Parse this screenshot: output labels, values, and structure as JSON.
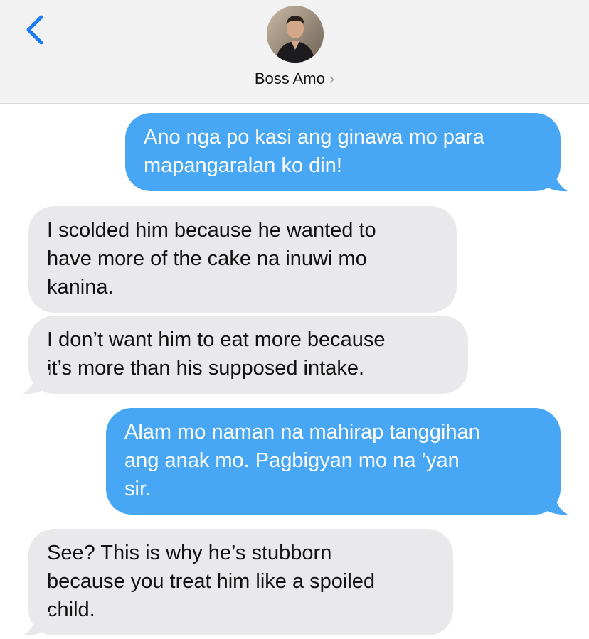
{
  "header": {
    "contact_name": "Boss Amo",
    "chevron": "›",
    "back_icon": "chevron-left-icon",
    "accent": "#1a7cf5"
  },
  "colors": {
    "outgoing_bubble": "#47a7f5",
    "incoming_bubble": "#e9e9eb"
  },
  "messages": [
    {
      "direction": "outgoing",
      "lines": [
        "Ano nga po kasi ang ginawa mo para",
        "mapangaralan ko din!"
      ]
    },
    {
      "direction": "incoming",
      "lines": [
        "I scolded him because he wanted to",
        "have more of the cake na inuwi mo",
        "kanina."
      ]
    },
    {
      "direction": "incoming",
      "lines": [
        "I don’t want him to eat more because",
        "it’s more than his supposed intake."
      ]
    },
    {
      "direction": "outgoing",
      "lines": [
        "Alam mo naman na mahirap tanggihan",
        "ang anak mo. Pagbigyan mo na ’yan",
        "sir."
      ]
    },
    {
      "direction": "incoming",
      "lines": [
        "See? This is why he’s stubborn",
        "because you treat him like a spoiled",
        "child."
      ]
    }
  ]
}
